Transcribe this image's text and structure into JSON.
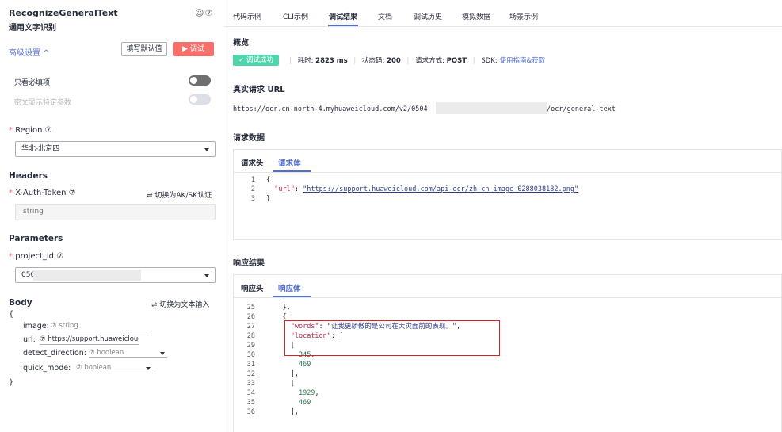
{
  "api": {
    "name": "RecognizeGeneralText",
    "subtitle": "通用文字识别",
    "top_icons": "☺⑦"
  },
  "left": {
    "advanced_link": "高级设置 ^",
    "fill_default_button": "填写默认值",
    "debug_button": "▶ 调试",
    "only_required_label": "只看必填项",
    "param_display_label": "密文显示特定参数",
    "region_label": "Region ⑦",
    "region_value": "华北-北京四",
    "headers_title": "Headers",
    "xauth_label": "X-Auth-Token ⑦",
    "switch_aksk": "⇌  切换为AK/SK认证",
    "xauth_placeholder": "string",
    "parameters_title": "Parameters",
    "project_id_label": "project_id ⑦",
    "project_id_value": "0504",
    "body_title": "Body",
    "switch_text_input": "⇌  切换为文本输入",
    "body_open": "{",
    "body_close": "}",
    "fields": [
      {
        "name": "image:",
        "hint": "⑦ string"
      },
      {
        "name": "url:",
        "hint": "⑦ https://support.huaweiclouc"
      },
      {
        "name": "detect_direction:",
        "hint": "⑦ boolean"
      },
      {
        "name": "quick_mode:",
        "hint": "⑦ boolean"
      }
    ],
    "required_mark": "*"
  },
  "tabs": [
    "代码示例",
    "CLI示例",
    "调试结果",
    "文档",
    "调试历史",
    "模拟数据",
    "场景示例"
  ],
  "overview": {
    "title": "概览",
    "status_badge": "✓ 调试成功",
    "time_label": "耗时: ",
    "time_value": "2823 ms",
    "status_label": "状态码: ",
    "status_value": "200",
    "method_label": "请求方式: ",
    "method_value": "POST",
    "sdk_label": "SDK: ",
    "sdk_link": "使用指南&获取",
    "separator": "|"
  },
  "request_url": {
    "title": "真实请求 URL",
    "prefix": "https://ocr.cn-north-4.myhuaweicloud.com/v2/0504",
    "suffix": "/ocr/general-text"
  },
  "request_data": {
    "title": "请求数据",
    "tab_header": "请求头",
    "tab_body": "请求体",
    "lines": [
      {
        "n": "1",
        "text": "{"
      },
      {
        "n": "2",
        "key": "\"url\"",
        "colon": ": ",
        "value": "\"https://support.huaweicloud.com/api-ocr/zh-cn_image_0288038182.png\""
      },
      {
        "n": "3",
        "text": "}"
      }
    ]
  },
  "response": {
    "title": "响应结果",
    "tab_header": "响应头",
    "tab_body": "响应体",
    "lines": [
      {
        "n": "25",
        "text": "    },"
      },
      {
        "n": "26",
        "text": "    {"
      },
      {
        "n": "27",
        "key": "\"words\"",
        "colon": ": ",
        "value": "\"让我更骄傲的是公司在大灾面前的表现。\"",
        "trail": ","
      },
      {
        "n": "28",
        "key": "\"location\"",
        "colon": ": ",
        "trail": "["
      },
      {
        "n": "29",
        "text": "      ["
      },
      {
        "n": "30",
        "num": "345",
        "trail": ","
      },
      {
        "n": "31",
        "num": "469"
      },
      {
        "n": "32",
        "text": "      ],"
      },
      {
        "n": "33",
        "text": "      ["
      },
      {
        "n": "34",
        "num": "1929",
        "trail": ","
      },
      {
        "n": "35",
        "num": "469"
      },
      {
        "n": "36",
        "text": "      ],"
      }
    ]
  },
  "colors": {
    "accent": "#526ecc",
    "danger": "#f66f6a",
    "success": "#50d4ab",
    "highlight": "#e02020"
  }
}
